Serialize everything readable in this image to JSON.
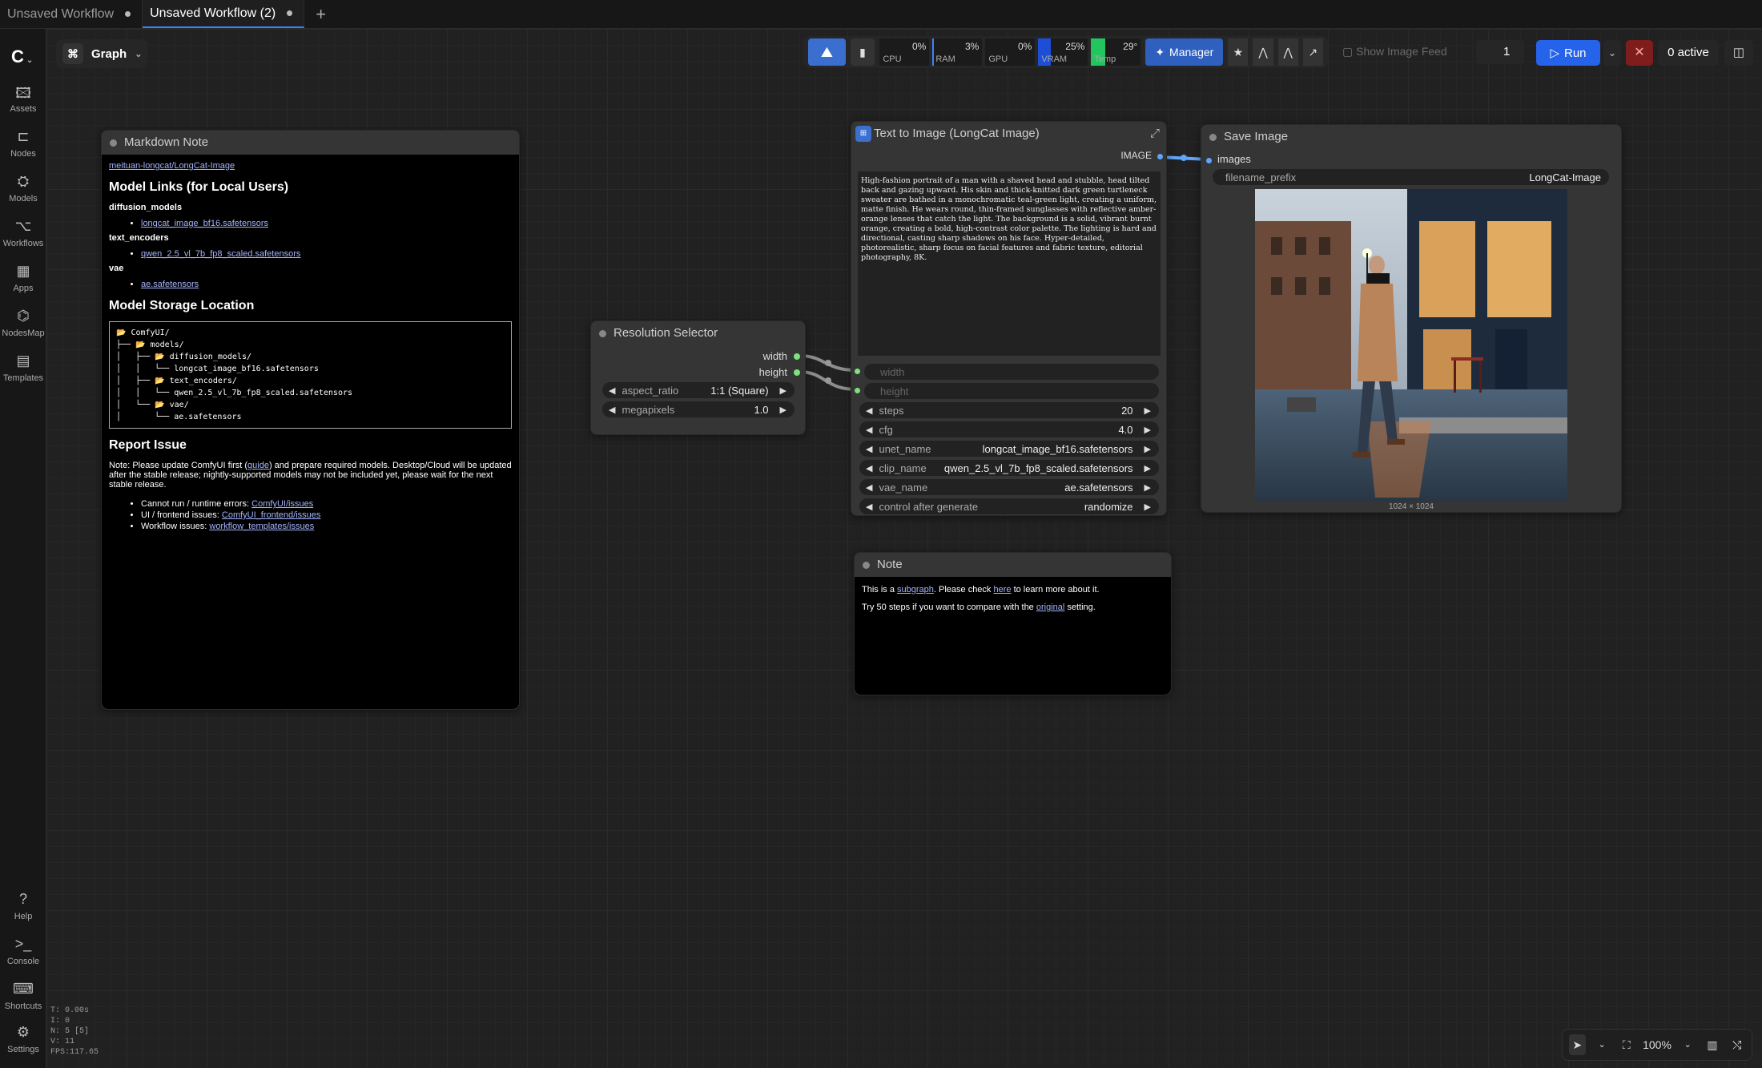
{
  "tabs": [
    {
      "label": "Unsaved Workflow",
      "active": false
    },
    {
      "label": "Unsaved Workflow (2)",
      "active": true
    }
  ],
  "sidebar": {
    "items": [
      {
        "label": "Assets",
        "icon": "image-icon"
      },
      {
        "label": "Nodes",
        "icon": "node-icon"
      },
      {
        "label": "Models",
        "icon": "models-icon"
      },
      {
        "label": "Workflows",
        "icon": "workflow-icon"
      },
      {
        "label": "Apps",
        "icon": "apps-icon"
      },
      {
        "label": "NodesMap",
        "icon": "nodesmap-icon"
      },
      {
        "label": "Templates",
        "icon": "templates-icon"
      }
    ],
    "bottom_items": [
      {
        "label": "Help",
        "icon": "help-icon"
      },
      {
        "label": "Console",
        "icon": "console-icon"
      },
      {
        "label": "Shortcuts",
        "icon": "keyboard-icon"
      },
      {
        "label": "Settings",
        "icon": "gear-icon"
      }
    ],
    "stats": [
      "T: 0.00s",
      "I: 0",
      "N: 5 [5]",
      "V: 11",
      "FPS:117.65"
    ]
  },
  "graph_pill": {
    "label": "Graph"
  },
  "toolbar": {
    "meters": [
      {
        "label": "CPU",
        "value": "0%",
        "fill": 0,
        "color": "#3b82f6"
      },
      {
        "label": "RAM",
        "value": "3%",
        "fill": 0.03,
        "color": "#3b82f6"
      },
      {
        "label": "GPU",
        "value": "0%",
        "fill": 0,
        "color": "#3b82f6"
      },
      {
        "label": "VRAM",
        "value": "25%",
        "fill": 0.25,
        "color": "#1d4ed8"
      },
      {
        "label": "Temp",
        "value": "29°",
        "fill": 0.29,
        "color": "#22c55e"
      }
    ],
    "manager_label": "Manager",
    "image_feed_label": "Show Image Feed",
    "queue_count": "1",
    "run_label": "Run",
    "active_label": "0 active"
  },
  "markdown_note": {
    "title": "Markdown Note",
    "repo_link": "meituan-longcat/LongCat-Image",
    "h_model_links": "Model Links (for Local Users)",
    "diffusion_label": "diffusion_models",
    "diffusion_file": "longcat_image_bf16.safetensors",
    "text_enc_label": "text_encoders",
    "text_enc_file": "qwen_2.5_vl_7b_fp8_scaled.safetensors",
    "vae_label": "vae",
    "vae_file": "ae.safetensors",
    "h_storage": "Model Storage Location",
    "tree": "📂 ComfyUI/\n├── 📂 models/\n│   ├── 📂 diffusion_models/\n│   │   └── longcat_image_bf16.safetensors\n│   ├── 📂 text_encoders/\n│   │   └── qwen_2.5_vl_7b_fp8_scaled.safetensors\n│   └── 📂 vae/\n│       └── ae.safetensors",
    "h_report": "Report Issue",
    "report_pre": "Note: Please update ComfyUI first (",
    "report_guide": "guide",
    "report_post": ") and prepare required models. Desktop/Cloud will be updated after the stable release; nightly-supported models may not be included yet, please wait for the next stable release.",
    "issues": [
      {
        "label": "Cannot run / runtime errors: ",
        "link": "ComfyUI/issues"
      },
      {
        "label": "UI / frontend issues: ",
        "link": "ComfyUI_frontend/issues"
      },
      {
        "label": "Workflow issues: ",
        "link": "workflow_templates/issues"
      }
    ]
  },
  "resolution_selector": {
    "title": "Resolution Selector",
    "out_width": "width",
    "out_height": "height",
    "aspect_ratio_name": "aspect_ratio",
    "aspect_ratio_value": "1:1 (Square)",
    "megapixels_name": "megapixels",
    "megapixels_value": "1.0"
  },
  "text_to_image": {
    "title": "Text to Image (LongCat Image)",
    "output": "IMAGE",
    "prompt": "High-fashion portrait of a man with a shaved head and stubble, head tilted back and gazing upward. His skin and thick-knitted dark green turtleneck sweater are bathed in a monochromatic teal-green light, creating a uniform, matte finish. He wears round, thin-framed sunglasses with reflective amber-orange lenses that catch the light. The background is a solid, vibrant burnt orange, creating a bold, high-contrast color palette. The lighting is hard and directional, casting sharp shadows on his face. Hyper-detailed, photorealistic, sharp focus on facial features and fabric texture, editorial photography, 8K.",
    "in_width": "width",
    "in_height": "height",
    "widgets": [
      {
        "name": "steps",
        "value": "20"
      },
      {
        "name": "cfg",
        "value": "4.0"
      },
      {
        "name": "unet_name",
        "value": "longcat_image_bf16.safetensors"
      },
      {
        "name": "clip_name",
        "value": "qwen_2.5_vl_7b_fp8_scaled.safetensors"
      },
      {
        "name": "vae_name",
        "value": "ae.safetensors"
      },
      {
        "name": "control after generate",
        "value": "randomize"
      }
    ]
  },
  "save_image": {
    "title": "Save Image",
    "input": "images",
    "prefix_name": "filename_prefix",
    "prefix_value": "LongCat-Image",
    "size_label": "1024 × 1024"
  },
  "note": {
    "title": "Note",
    "l1_pre": "This is a ",
    "l1_link1": "subgraph",
    "l1_mid": ". Please check ",
    "l1_link2": "here",
    "l1_post": " to learn more about it.",
    "l2_pre": "Try 50 steps if you want to compare with the ",
    "l2_link": "original",
    "l2_post": " setting."
  },
  "canvas_controls": {
    "zoom": "100%"
  },
  "colors": {
    "accent": "#2563eb",
    "slot_green": "#7ee07e",
    "link_blue": "#60a5fa"
  }
}
